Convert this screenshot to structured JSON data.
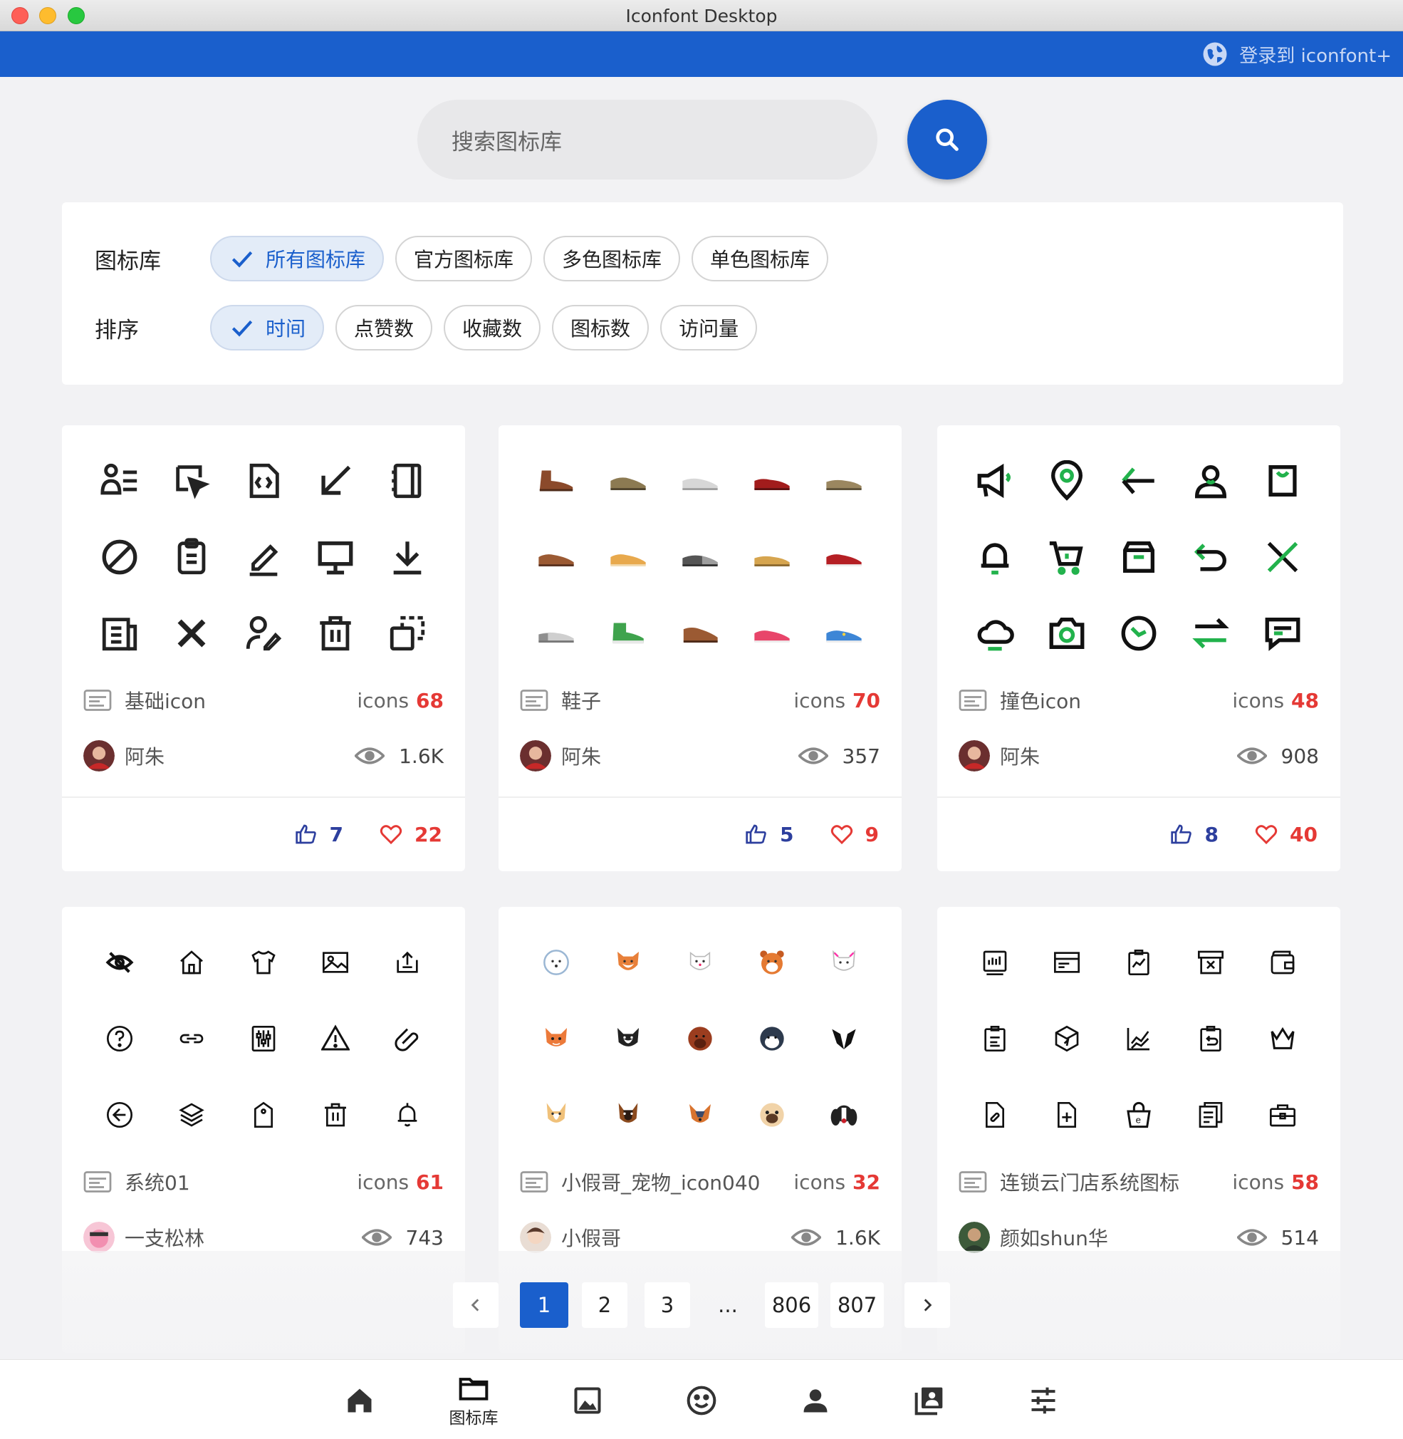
{
  "window": {
    "title": "Iconfont Desktop"
  },
  "appbar": {
    "login_label": "登录到 iconfont+"
  },
  "search": {
    "placeholder": "搜索图标库"
  },
  "filters": {
    "library_label": "图标库",
    "library_options": [
      "所有图标库",
      "官方图标库",
      "多色图标库",
      "单色图标库"
    ],
    "library_selected": "所有图标库",
    "sort_label": "排序",
    "sort_options": [
      "时间",
      "点赞数",
      "收藏数",
      "图标数",
      "访问量"
    ],
    "sort_selected": "时间"
  },
  "cards": [
    {
      "name": "基础icon",
      "icons_label": "icons",
      "icons_count": "68",
      "author": "阿朱",
      "views": "1.6K",
      "likes": "7",
      "favorites": "22"
    },
    {
      "name": "鞋子",
      "icons_label": "icons",
      "icons_count": "70",
      "author": "阿朱",
      "views": "357",
      "likes": "5",
      "favorites": "9"
    },
    {
      "name": "撞色icon",
      "icons_label": "icons",
      "icons_count": "48",
      "author": "阿朱",
      "views": "908",
      "likes": "8",
      "favorites": "40"
    },
    {
      "name": "系统01",
      "icons_label": "icons",
      "icons_count": "61",
      "author": "一支松林",
      "views": "743"
    },
    {
      "name": "小假哥_宠物_icon040",
      "icons_label": "icons",
      "icons_count": "32",
      "author": "小假哥",
      "views": "1.6K"
    },
    {
      "name": "连锁云门店系统图标",
      "icons_label": "icons",
      "icons_count": "58",
      "author": "颜如shun华",
      "views": "514"
    }
  ],
  "pagination": {
    "pages": [
      "1",
      "2",
      "3",
      "...",
      "806",
      "807"
    ],
    "current": "1"
  },
  "bottom_nav": {
    "library_label": "图标库"
  },
  "colors": {
    "brand": "#1a5fcc",
    "accent_red": "#e53935",
    "like_blue": "#2d3f9e"
  }
}
